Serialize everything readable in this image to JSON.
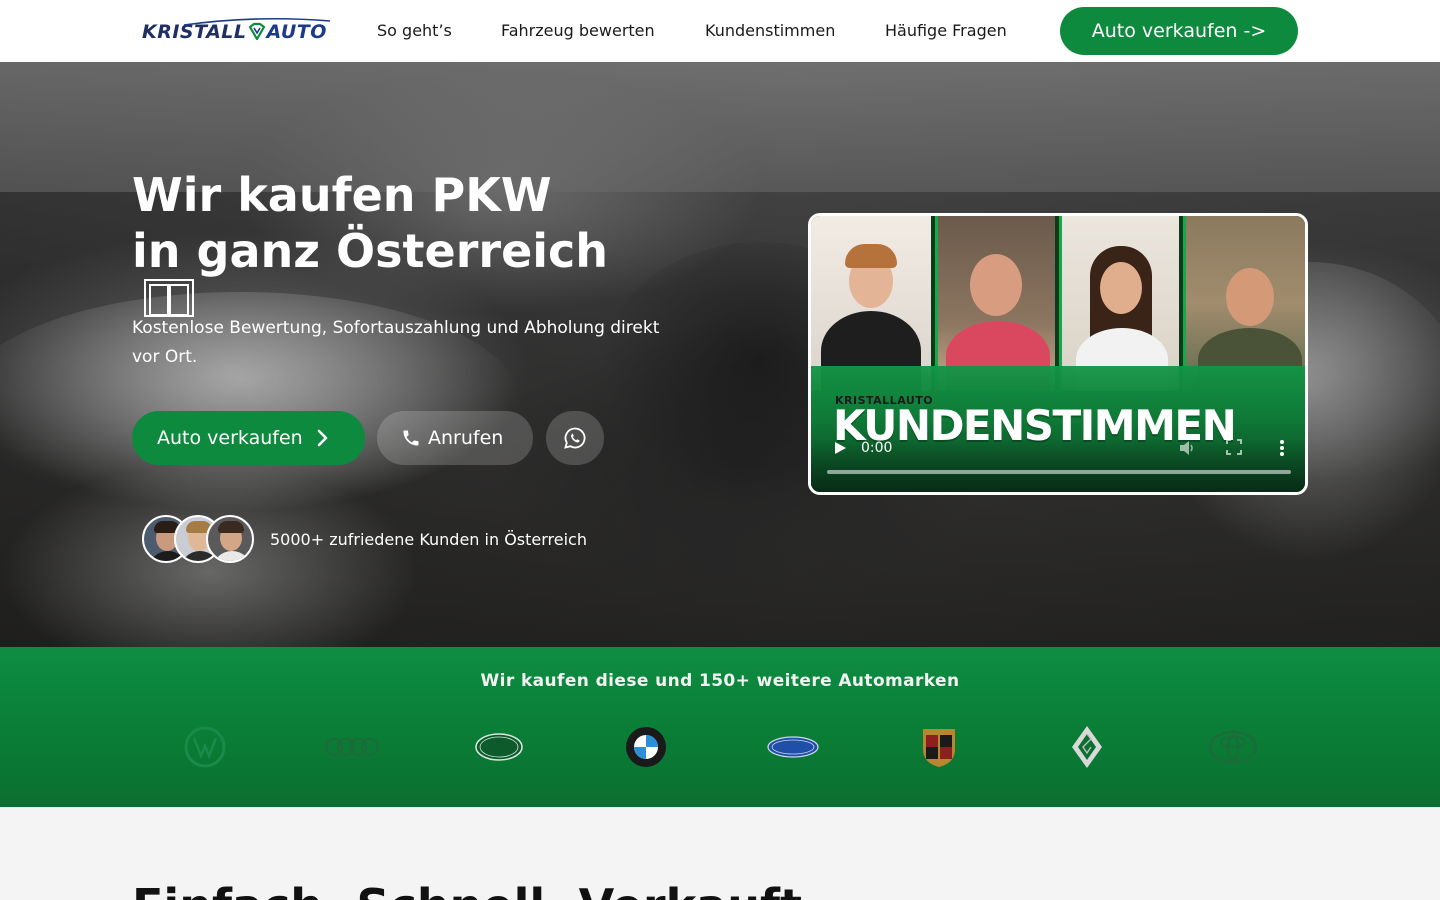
{
  "nav": {
    "logo_part1": "KRISTALL",
    "logo_part2": "AUTO",
    "links": [
      "So geht’s",
      "Fahrzeug bewerten",
      "Kundenstimmen",
      "Häufige Fragen"
    ],
    "cta": "Auto verkaufen ->"
  },
  "hero": {
    "title_line1": "Wir kaufen PKW",
    "title_line2": "in ganz Österreich",
    "subtitle": "Kostenlose Bewertung, Sofortauszahlung und Abholung direkt vor Ort.",
    "primary_button": "Auto verkaufen",
    "call_button": "Anrufen",
    "social_proof": "5000+ zufriedene Kunden in Österreich"
  },
  "video": {
    "brand": "KRISTALLAUTO",
    "title": "KUNDENSTIMMEN",
    "time": "0:00"
  },
  "brands": {
    "title": "Wir kaufen diese und 150+ weitere Automarken",
    "logos": [
      "vw-logo",
      "audi-logo",
      "land-rover-logo",
      "bmw-logo",
      "ford-logo",
      "porsche-logo",
      "renault-logo",
      "toyota-logo"
    ]
  },
  "section": {
    "title_light": "Einfach. Schnell.",
    "title_bold": "Verkauft."
  },
  "colors": {
    "accent": "#0e8a3e",
    "logo_blue": "#1c3a8a"
  }
}
